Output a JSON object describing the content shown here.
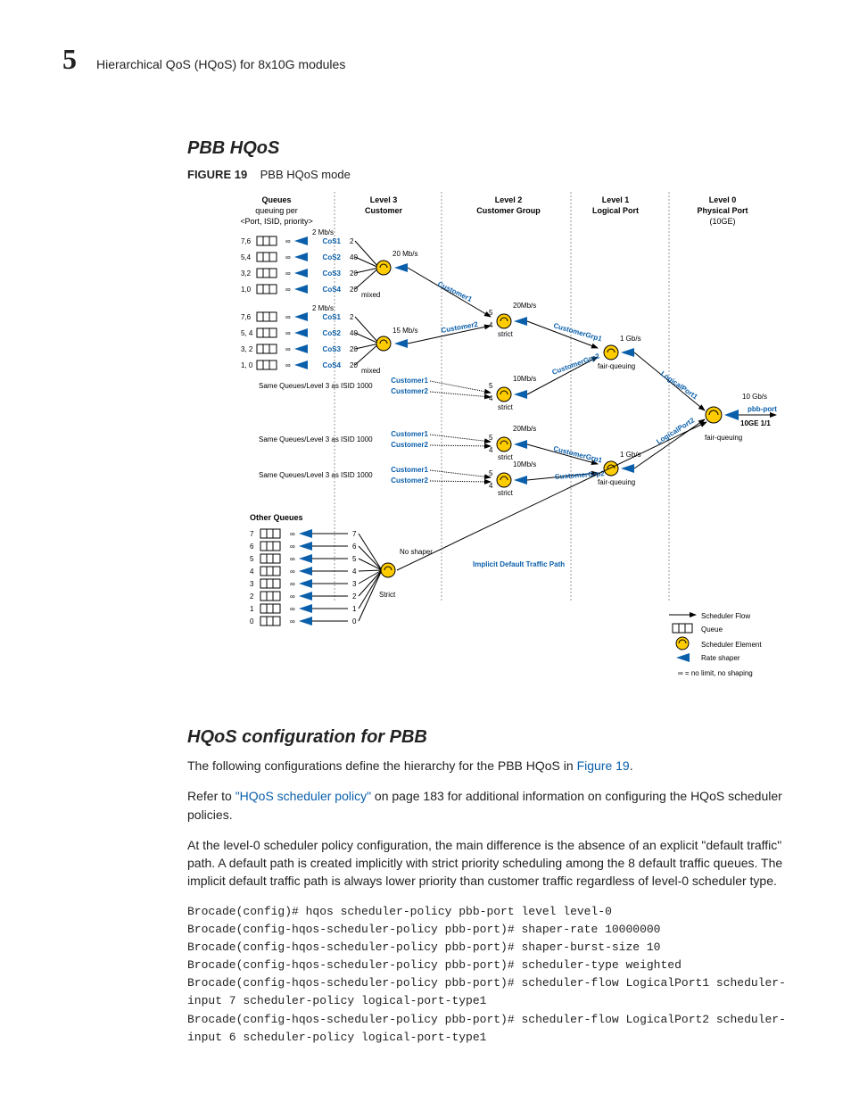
{
  "header": {
    "chapter": "5",
    "title": "Hierarchical QoS (HQoS) for 8x10G modules"
  },
  "section1": {
    "title": "PBB HQoS"
  },
  "figure": {
    "label": "FIGURE 19",
    "caption": "PBB HQoS mode",
    "columns": {
      "queues_title": "Queues",
      "queues_sub1": "queuing per",
      "queues_sub2": "<Port, ISID, priority>",
      "l3": "Level 3",
      "l3_sub": "Customer",
      "l2": "Level 2",
      "l2_sub": "Customer Group",
      "l1": "Level 1",
      "l1_sub": "Logical Port",
      "l0": "Level 0",
      "l0_sub": "Physical Port",
      "l0_note": "(10GE)"
    },
    "block1": {
      "q_labels": [
        "7,6",
        "5,4",
        "3,2",
        "1,0"
      ],
      "rate_top": "2 Mb/s",
      "cos": [
        "CoS1",
        "CoS2",
        "CoS3",
        "CoS4"
      ],
      "cos_vals": [
        "2",
        "40",
        "20",
        "20"
      ],
      "shaper_rate": "20 Mb/s",
      "sched_type": "mixed",
      "flow_label": "Customer1"
    },
    "block2": {
      "q_labels": [
        "7,6",
        "5, 4",
        "3, 2",
        "1, 0"
      ],
      "rate_top": "2 Mb/s",
      "cos": [
        "CoS1",
        "CoS2",
        "CoS3",
        "CoS4"
      ],
      "cos_vals": [
        "2",
        "40",
        "20",
        "20"
      ],
      "shaper_rate": "15 Mb/s",
      "sched_type": "mixed",
      "flow_label": "Customer2"
    },
    "repeat_row": "Same Queues/Level 3 as ISID 1000",
    "repeat_cust": [
      "Customer1",
      "Customer2"
    ],
    "grp": {
      "g1": "CustomerGrp1",
      "g2": "CustomerGrp2",
      "rate_a": "20Mb/s",
      "rate_b": "10Mb/s",
      "rate_log": "1 Gb/s",
      "mode_strict": "strict",
      "mode_fq": "fair-queuing",
      "in5": "5",
      "in4": "4"
    },
    "logport": {
      "l1": "LogicalPort1",
      "l2": "LogicalPort2"
    },
    "phys": {
      "rate": "10 Gb/s",
      "name": "pbb-port",
      "if": "10GE 1/1",
      "mode": "fair-queuing"
    },
    "other": {
      "title": "Other Queues",
      "nums": [
        "7",
        "6",
        "5",
        "4",
        "3",
        "2",
        "1",
        "0"
      ],
      "noshaper": "No shaper",
      "strict": "Strict",
      "implicit": "Implicit Default Traffic Path"
    },
    "legend": {
      "flow": "Scheduler Flow",
      "queue": "Queue",
      "elem": "Scheduler Element",
      "shaper": "Rate shaper",
      "inf": "∞ = no limit, no shaping"
    },
    "inf": "∞"
  },
  "section2": {
    "title": "HQoS configuration for PBB",
    "p1a": "The following configurations define the hierarchy for the PBB HQoS in ",
    "p1_link": "Figure 19",
    "p1b": ".",
    "p2a": "Refer to ",
    "p2_link": "\"HQoS scheduler policy\"",
    "p2b": " on page 183 for additional information on configuring the HQoS scheduler policies.",
    "p3": "At the level-0 scheduler policy configuration, the main difference is the absence of an explicit \"default traffic\" path. A default path is created implicitly with strict priority scheduling among the 8 default traffic queues. The implicit default traffic path is always lower priority than customer traffic regardless of level-0 scheduler type.",
    "code": "Brocade(config)# hqos scheduler-policy pbb-port level level-0\nBrocade(config-hqos-scheduler-policy pbb-port)# shaper-rate 10000000\nBrocade(config-hqos-scheduler-policy pbb-port)# shaper-burst-size 10\nBrocade(config-hqos-scheduler-policy pbb-port)# scheduler-type weighted\nBrocade(config-hqos-scheduler-policy pbb-port)# scheduler-flow LogicalPort1 scheduler-input 7 scheduler-policy logical-port-type1\nBrocade(config-hqos-scheduler-policy pbb-port)# scheduler-flow LogicalPort2 scheduler-input 6 scheduler-policy logical-port-type1"
  }
}
